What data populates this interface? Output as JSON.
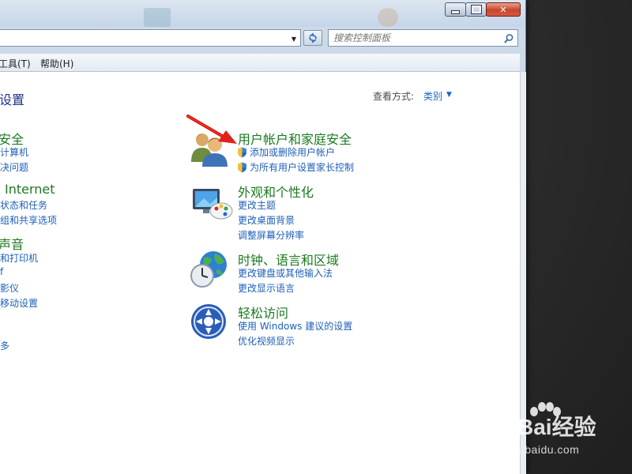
{
  "search": {
    "placeholder": "搜索控制面板"
  },
  "menubar": {
    "tools": "工具(T)",
    "help": "帮助(H)"
  },
  "page_title": "设置",
  "view_by": {
    "label": "查看方式:",
    "value": "类别"
  },
  "left_column": {
    "cat1_title": "安全",
    "cat1_links": [
      "计算机",
      "决问题"
    ],
    "cat2_title": "Internet",
    "cat2_links": [
      "状态和任务",
      "组和共享选项"
    ],
    "cat3_title": "声音",
    "cat3_links": [
      "和打印机",
      "影仪",
      "移动设置"
    ]
  },
  "categories": [
    {
      "title": "用户帐户和家庭安全",
      "icon": "users-icon",
      "links": [
        "添加或删除用户帐户",
        "为所有用户设置家长控制"
      ]
    },
    {
      "title": "外观和个性化",
      "icon": "monitor-palette-icon",
      "links": [
        "更改主题",
        "更改桌面背景",
        "调整屏幕分辨率"
      ]
    },
    {
      "title": "时钟、语言和区域",
      "icon": "globe-clock-icon",
      "links": [
        "更改键盘或其他输入法",
        "更改显示语言"
      ]
    },
    {
      "title": "轻松访问",
      "icon": "ease-of-access-icon",
      "links": [
        "使用 Windows 建议的设置",
        "优化视频显示"
      ]
    }
  ],
  "watermark": {
    "brand": "Bai经验",
    "url": "jingyan.baidu.com"
  },
  "colors": {
    "category_title": "#1b7a1f",
    "link": "#1e5fb8",
    "arrow": "#e0221a"
  }
}
